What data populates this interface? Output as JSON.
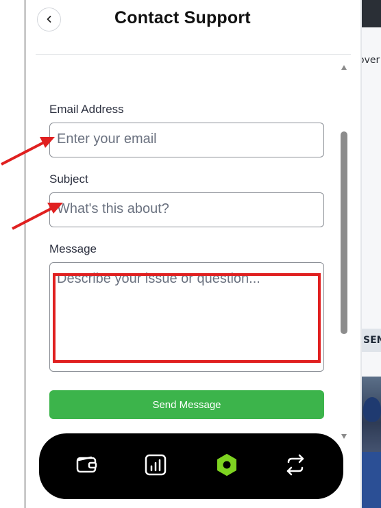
{
  "header": {
    "title": "Contact Support",
    "back_icon": "chevron-left-icon"
  },
  "form": {
    "email": {
      "label": "Email Address",
      "placeholder": "Enter your email"
    },
    "subject": {
      "label": "Subject",
      "placeholder": "What's this about?"
    },
    "message": {
      "label": "Message",
      "placeholder": "Describe your issue or question..."
    },
    "submit_label": "Send Message"
  },
  "bottom_nav": {
    "items": [
      {
        "icon": "wallet-icon"
      },
      {
        "icon": "chart-bars-icon"
      },
      {
        "icon": "hexagon-icon",
        "active": true
      },
      {
        "icon": "swap-arrows-icon"
      }
    ]
  },
  "background_page": {
    "text_top": "over",
    "text_button": "SEN"
  },
  "colors": {
    "accent_green": "#3cb44b",
    "active_icon": "#7ed321",
    "annotation_red": "#e02020",
    "nav_bg": "#000000"
  }
}
